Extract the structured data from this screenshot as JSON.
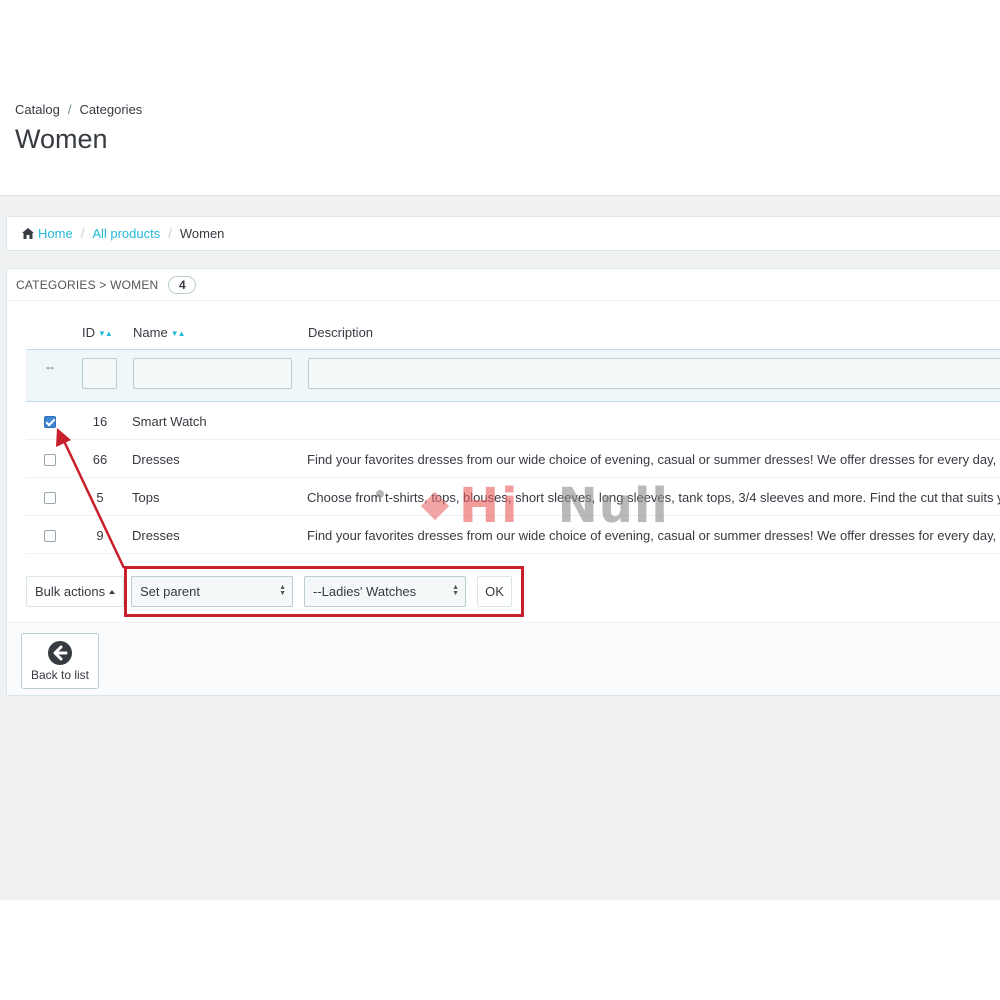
{
  "page_head": {
    "breadcrumb": [
      "Catalog",
      "Categories"
    ],
    "title": "Women"
  },
  "nav": {
    "home_icon": "home-icon",
    "items": [
      "Home",
      "All products",
      "Women"
    ]
  },
  "panel": {
    "heading": "CATEGORIES > WOMEN",
    "count": "4"
  },
  "table": {
    "columns": [
      "ID",
      "Name",
      "Description"
    ],
    "filter_placeholder_dash": "--",
    "rows": [
      {
        "checked": true,
        "id": "16",
        "name": "Smart Watch",
        "description": ""
      },
      {
        "checked": false,
        "id": "66",
        "name": "Dresses",
        "description": "Find your favorites dresses from our wide choice of evening, casual or summer dresses! We offer dresses for every day, ever"
      },
      {
        "checked": false,
        "id": "5",
        "name": "Tops",
        "description": "Choose from t-shirts, tops, blouses, short sleeves, long sleeves, tank tops, 3/4 sleeves and more. Find the cut that suits you th"
      },
      {
        "checked": false,
        "id": "9",
        "name": "Dresses",
        "description": "Find your favorites dresses from our wide choice of evening, casual or summer dresses! We offer dresses for every day, ever"
      }
    ]
  },
  "bulk": {
    "bulk_label": "Bulk actions",
    "action_select": "Set parent",
    "parent_select": "--Ladies' Watches",
    "ok_label": "OK"
  },
  "footer": {
    "back_label": "Back to list",
    "back_icon": "arrow-left-circle-icon"
  },
  "watermark": {
    "text_left": "Hi",
    "text_right": "Null"
  },
  "colors": {
    "link": "#25b9d7",
    "highlight": "#c8202a",
    "checkbox": "#3f86d3"
  }
}
